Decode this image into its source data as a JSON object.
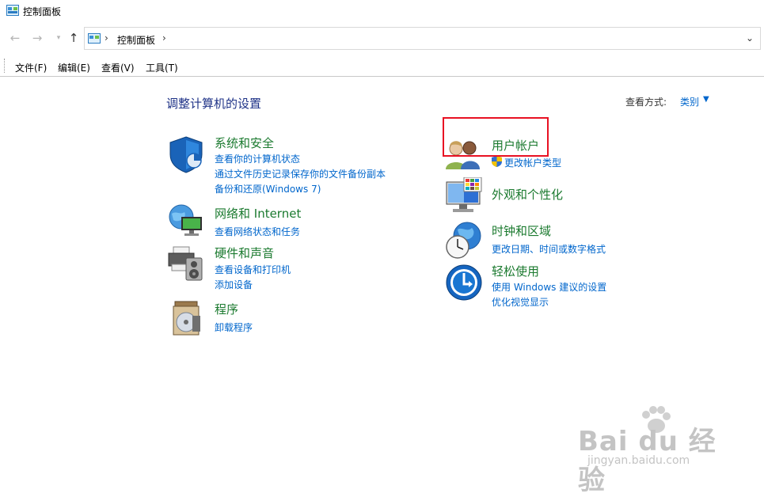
{
  "window": {
    "title": "控制面板"
  },
  "address_bar": {
    "crumb": "控制面板"
  },
  "menu": {
    "file": "文件(F)",
    "edit": "编辑(E)",
    "view": "查看(V)",
    "tools": "工具(T)"
  },
  "main": {
    "heading": "调整计算机的设置",
    "view_by_label": "查看方式:",
    "view_by_value": "类别"
  },
  "categories": {
    "system_security": {
      "title": "系统和安全",
      "links": [
        "查看你的计算机状态",
        "通过文件历史记录保存你的文件备份副本",
        "备份和还原(Windows 7)"
      ]
    },
    "network": {
      "title": "网络和 Internet",
      "links": [
        "查看网络状态和任务"
      ]
    },
    "hardware": {
      "title": "硬件和声音",
      "links": [
        "查看设备和打印机",
        "添加设备"
      ]
    },
    "programs": {
      "title": "程序",
      "links": [
        "卸载程序"
      ]
    },
    "user_accounts": {
      "title": "用户帐户",
      "links": [
        "更改帐户类型"
      ]
    },
    "appearance": {
      "title": "外观和个性化",
      "links": []
    },
    "clock_region": {
      "title": "时钟和区域",
      "links": [
        "更改日期、时间或数字格式"
      ]
    },
    "ease_of_access": {
      "title": "轻松使用",
      "links": [
        "使用 Windows 建议的设置",
        "优化视觉显示"
      ]
    }
  },
  "watermark": {
    "brand": "Bai du 经验",
    "url": "jingyan.baidu.com"
  },
  "colors": {
    "link": "#0066cc",
    "category_title": "#1b7a2f",
    "heading": "#1e3287",
    "highlight": "#e81123"
  }
}
